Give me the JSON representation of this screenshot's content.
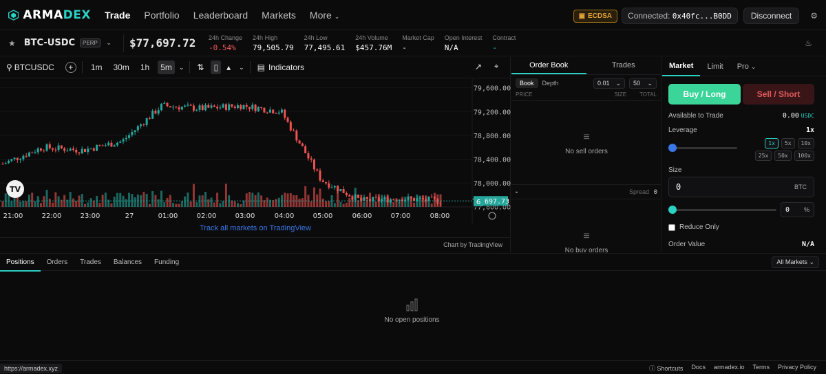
{
  "brand": {
    "name_main": "ARMA",
    "name_accent": "DEX"
  },
  "nav": {
    "trade": "Trade",
    "portfolio": "Portfolio",
    "leaderboard": "Leaderboard",
    "markets": "Markets",
    "more": "More"
  },
  "account": {
    "key_type": "ECDSA",
    "connected_label": "Connected:",
    "address": "0x40fc...B0DD",
    "disconnect": "Disconnect"
  },
  "market": {
    "pair": "BTC-USDC",
    "type": "PERP",
    "price": "$77,697.72",
    "stats": [
      {
        "label": "24h Change",
        "value": "-0.54%",
        "tone": "red"
      },
      {
        "label": "24h High",
        "value": "79,505.79",
        "tone": "white"
      },
      {
        "label": "24h Low",
        "value": "77,495.61",
        "tone": "white"
      },
      {
        "label": "24h Volume",
        "value": "$457.76M",
        "tone": "white"
      },
      {
        "label": "Market Cap",
        "value": "-",
        "tone": "white"
      },
      {
        "label": "Open Interest",
        "value": "N/A",
        "tone": "white"
      },
      {
        "label": "Contract",
        "value": "-",
        "tone": "teal"
      }
    ]
  },
  "chart": {
    "symbol": "BTCUSDC",
    "intervals": [
      "1m",
      "30m",
      "1h",
      "5m"
    ],
    "selected_interval": "5m",
    "indicators": "Indicators",
    "tv_link": "Track all markets on TradingView",
    "credit": "Chart by TradingView",
    "last_price_label": "77,697.73",
    "volume_badge": "6",
    "y_ticks": [
      "79,600.00",
      "79,200.00",
      "78,800.00",
      "78,400.00",
      "78,000.00",
      "77,600.00"
    ],
    "x_ticks": [
      "21:00",
      "22:00",
      "23:00",
      "27",
      "01:00",
      "02:00",
      "03:00",
      "04:00",
      "05:00",
      "06:00",
      "07:00",
      "08:00"
    ],
    "up_color": "#26a69a",
    "down_color": "#ef5350"
  },
  "chart_data": {
    "type": "candlestick",
    "title": "BTCUSDC 5m",
    "x": [
      "21:00",
      "22:00",
      "23:00",
      "27",
      "01:00",
      "02:00",
      "03:00",
      "04:00",
      "05:00",
      "06:00",
      "07:00",
      "08:00"
    ],
    "close": [
      78320,
      78600,
      78550,
      78700,
      79300,
      79250,
      79300,
      79200,
      78050,
      77700,
      77740,
      77697
    ],
    "ylim": [
      77550,
      79700
    ],
    "last": 77697.73
  },
  "orderbook": {
    "tab_book": "Order Book",
    "tab_trades": "Trades",
    "mode_book": "Book",
    "mode_depth": "Depth",
    "tick": "0.01",
    "rows": "50",
    "col_price": "PRICE",
    "col_size": "SIZE",
    "col_total": "TOTAL",
    "no_sell": "No sell orders",
    "no_buy": "No buy orders",
    "spread_label": "Spread",
    "spread_value": "0",
    "mid": "-"
  },
  "trade": {
    "tab_market": "Market",
    "tab_limit": "Limit",
    "tab_pro": "Pro",
    "buy": "Buy / Long",
    "sell": "Sell / Short",
    "available_label": "Available to Trade",
    "available_value": "0.00",
    "available_unit": "USDC",
    "leverage_label": "Leverage",
    "leverage_value": "1x",
    "leverage_opts": [
      "1x",
      "5x",
      "10x",
      "25x",
      "50x",
      "100x"
    ],
    "size_label": "Size",
    "size_value": "0",
    "size_unit": "BTC",
    "pct_value": "0",
    "pct_unit": "%",
    "reduce_only": "Reduce Only",
    "order_value_label": "Order Value",
    "order_value": "N/A"
  },
  "bottom": {
    "tabs": [
      "Positions",
      "Orders",
      "Trades",
      "Balances",
      "Funding"
    ],
    "filter": "All Markets",
    "empty": "No open positions"
  },
  "footer": {
    "url": "https://armadex.xyz",
    "links": [
      "Shortcuts",
      "Docs",
      "armadex.io",
      "Terms",
      "Privacy Policy"
    ]
  }
}
